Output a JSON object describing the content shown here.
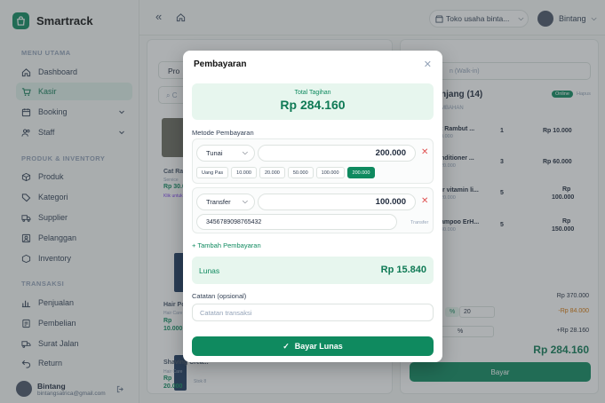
{
  "app": {
    "name": "Smartrack"
  },
  "topbar": {
    "store": "Toko usaha binta...",
    "user": "Bintang"
  },
  "sidebar": {
    "section_main": "MENU UTAMA",
    "section_products": "PRODUK & INVENTORY",
    "section_transactions": "TRANSAKSI",
    "items": [
      {
        "label": "Dashboard",
        "icon": "home-icon"
      },
      {
        "label": "Kasir",
        "icon": "cart-icon"
      },
      {
        "label": "Booking",
        "icon": "calendar-icon"
      },
      {
        "label": "Staff",
        "icon": "users-icon"
      },
      {
        "label": "Produk",
        "icon": "box-icon"
      },
      {
        "label": "Kategori",
        "icon": "tag-icon"
      },
      {
        "label": "Supplier",
        "icon": "truck-icon"
      },
      {
        "label": "Pelanggan",
        "icon": "customer-icon"
      },
      {
        "label": "Inventory",
        "icon": "inventory-icon"
      },
      {
        "label": "Penjualan",
        "icon": "chart-icon"
      },
      {
        "label": "Pembelian",
        "icon": "receipt-icon"
      },
      {
        "label": "Surat Jalan",
        "icon": "delivery-icon"
      },
      {
        "label": "Return",
        "icon": "return-icon"
      }
    ],
    "user": {
      "name": "Bintang",
      "email": "bintangsatrica@gmail.com"
    }
  },
  "background": {
    "tab_label": "Pro",
    "search": "C",
    "customer": "n (Walk-in)",
    "cart_title": "njang (14)",
    "cart_sub": "MBAHAN",
    "badge_online": "Online",
    "badge_hapus": "Hapus",
    "products": [
      {
        "name": "Cat Ra",
        "sub": "Service",
        "price": "Rp 30.0",
        "stock": "Klik untuk"
      },
      {
        "name": "Hair Po",
        "sub": "Hair Care",
        "price": "Rp",
        "price2": "10.000"
      },
      {
        "name": "Shaving Crea...",
        "sub": "Hair Care",
        "price": "Rp",
        "price2": "20.000",
        "stock": "Stok 8"
      }
    ],
    "cart_items": [
      {
        "name": "t Rambut ...",
        "unit": "0.000",
        "qty": "1",
        "total": "Rp 10.000"
      },
      {
        "name": "nditioner ...",
        "unit": "20.000",
        "qty": "3",
        "total": "Rp 60.000"
      },
      {
        "name": "ir vitamin li...",
        "unit": "20.000",
        "qty": "5",
        "total": "Rp",
        "total2": "100.000"
      },
      {
        "name": "ampoo ErH...",
        "unit": "30.000",
        "qty": "5",
        "total": "Rp",
        "total2": "150.000"
      }
    ],
    "subtotal": "Rp 370.000",
    "discount": "-Rp 84.000",
    "tax": "+Rp 28.160",
    "disc_type": "%",
    "disc_value": "20",
    "grand_total": "Rp 284.160",
    "pay_button": "Bayar"
  },
  "modal": {
    "title": "Pembayaran",
    "total_label": "Total Tagihan",
    "total_value": "Rp 284.160",
    "method_label": "Metode Pembayaran",
    "payments": [
      {
        "method": "Tunai",
        "amount": "200.000",
        "chips": [
          "Uang Pas",
          "10.000",
          "20.000",
          "50.000",
          "100.000",
          "200.000"
        ],
        "selected_chip": "200.000"
      },
      {
        "method": "Transfer",
        "amount": "100.000",
        "reference": "3456789098765432",
        "reference_label": "Transfer"
      }
    ],
    "add_payment": "+ Tambah Pembayaran",
    "status_label": "Lunas",
    "status_value": "Rp 15.840",
    "note_label": "Catatan (opsional)",
    "note_placeholder": "Catatan transaksi",
    "submit": "Bayar Lunas"
  },
  "colors": {
    "primary": "#0f8a5f",
    "primary_light": "#e7f6ee",
    "danger": "#e05252"
  }
}
